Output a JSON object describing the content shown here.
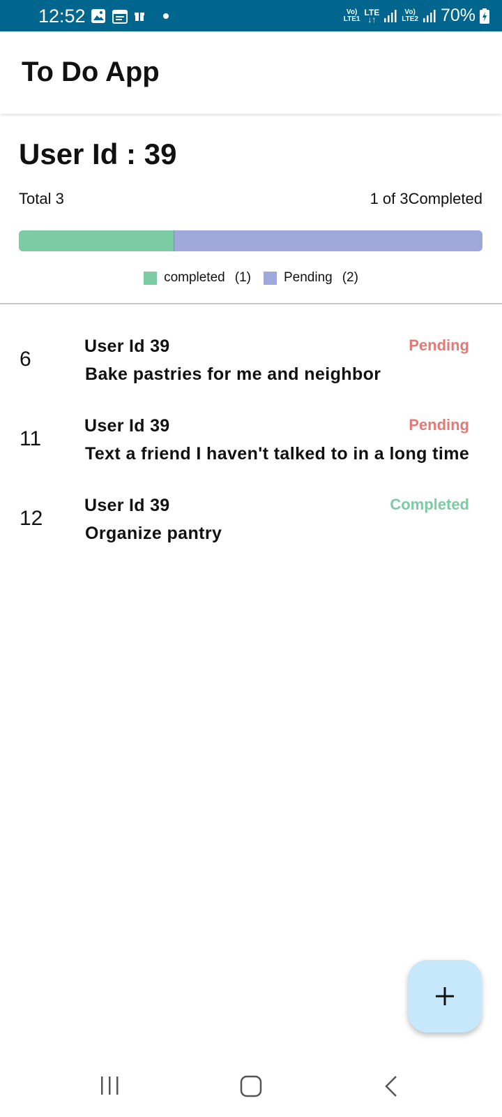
{
  "status_bar": {
    "time": "12:52",
    "icons": [
      "image-icon",
      "calendar-icon",
      "gift-icon",
      "dot-icon"
    ],
    "sim1_label_top": "Vo)",
    "sim1_label_bottom": "LTE1",
    "lte_label": "LTE",
    "sim2_label_top": "Vo)",
    "sim2_label_bottom": "LTE2",
    "battery": "70%"
  },
  "app_bar": {
    "title": "To Do App"
  },
  "summary": {
    "heading": "User Id : 39",
    "total_label": "Total 3",
    "completed_label": "1 of 3Completed",
    "progress_completed_fraction": 0.3333,
    "colors": {
      "completed": "#7ccba5",
      "pending": "#9fa8da"
    },
    "legend": [
      {
        "label": "completed",
        "count": "(1)"
      },
      {
        "label": "Pending",
        "count": "(2)"
      }
    ]
  },
  "todos": [
    {
      "id": "6",
      "user": "User Id  39",
      "title": "Bake pastries for me and neighbor",
      "status": "Pending",
      "status_color": "#e07b78"
    },
    {
      "id": "11",
      "user": "User Id  39",
      "title": "Text a friend I haven't talked to in a long time",
      "status": "Pending",
      "status_color": "#e07b78"
    },
    {
      "id": "12",
      "user": "User Id  39",
      "title": "Organize pantry",
      "status": "Completed",
      "status_color": "#7ccba5"
    }
  ],
  "fab": {
    "icon": "plus-icon"
  },
  "nav": {
    "icons": [
      "recent-apps-icon",
      "home-icon",
      "back-icon"
    ]
  }
}
